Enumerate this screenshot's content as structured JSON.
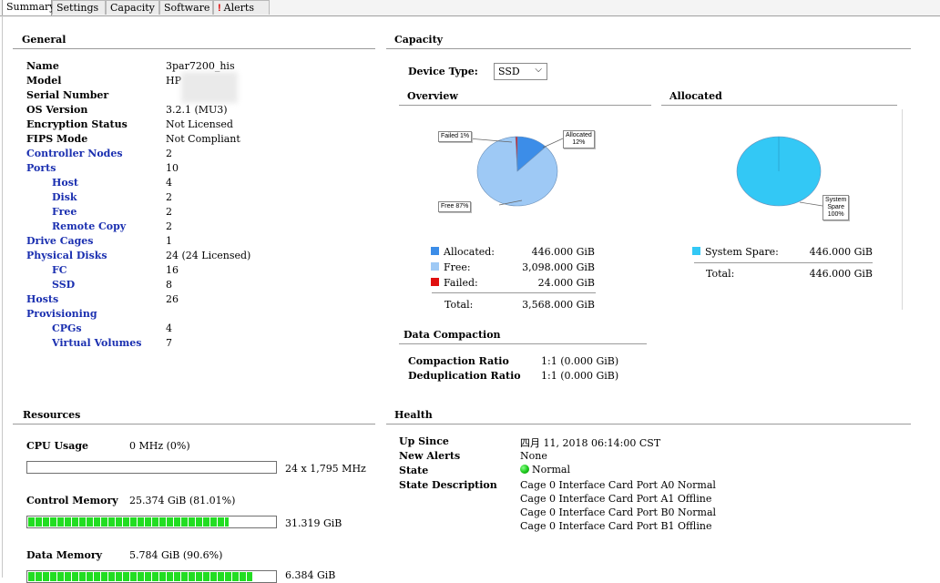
{
  "tabs": [
    {
      "label": "Summary",
      "active": true
    },
    {
      "label": "Settings"
    },
    {
      "label": "Capacity"
    },
    {
      "label": "Software"
    },
    {
      "label": "Alerts",
      "has_alert": true
    }
  ],
  "general": {
    "title": "General",
    "rows": [
      {
        "label": "Name",
        "value": "3par7200_his",
        "link": false,
        "indent": false
      },
      {
        "label": "Model",
        "value": "HP",
        "link": false,
        "indent": false
      },
      {
        "label": "Serial Number",
        "value": "",
        "link": false,
        "indent": false
      },
      {
        "label": "OS Version",
        "value": "3.2.1 (MU3)",
        "link": false,
        "indent": false
      },
      {
        "label": "Encryption Status",
        "value": "Not Licensed",
        "link": false,
        "indent": false
      },
      {
        "label": "FIPS Mode",
        "value": "Not Compliant",
        "link": false,
        "indent": false
      },
      {
        "label": "Controller Nodes",
        "value": "2",
        "link": true,
        "indent": false
      },
      {
        "label": "Ports",
        "value": "10",
        "link": true,
        "indent": false
      },
      {
        "label": "Host",
        "value": "4",
        "link": true,
        "indent": true
      },
      {
        "label": "Disk",
        "value": "2",
        "link": true,
        "indent": true
      },
      {
        "label": "Free",
        "value": "2",
        "link": true,
        "indent": true
      },
      {
        "label": "Remote Copy",
        "value": "2",
        "link": true,
        "indent": true
      },
      {
        "label": "Drive Cages",
        "value": "1",
        "link": true,
        "indent": false
      },
      {
        "label": "Physical Disks",
        "value": "24 (24 Licensed)",
        "link": true,
        "indent": false
      },
      {
        "label": "FC",
        "value": "16",
        "link": true,
        "indent": true
      },
      {
        "label": "SSD",
        "value": "8",
        "link": true,
        "indent": true
      },
      {
        "label": "Hosts",
        "value": "26",
        "link": true,
        "indent": false
      },
      {
        "label": "Provisioning",
        "value": "",
        "link": true,
        "indent": false
      },
      {
        "label": "CPGs",
        "value": "4",
        "link": true,
        "indent": true
      },
      {
        "label": "Virtual Volumes",
        "value": "7",
        "link": true,
        "indent": true
      }
    ]
  },
  "capacity": {
    "title": "Capacity",
    "device_type_label": "Device Type:",
    "device_type_value": "SSD",
    "overview": {
      "title": "Overview",
      "slices": [
        {
          "name": "Allocated",
          "percent": 12.5,
          "color": "#3c8de8",
          "callout": "Allocated\n12%"
        },
        {
          "name": "Free",
          "percent": 86.8,
          "color": "#9ec9f5",
          "callout": "Free 87%"
        },
        {
          "name": "Failed",
          "percent": 0.7,
          "color": "#e01010",
          "callout": "Failed 1%"
        }
      ],
      "legend": [
        {
          "label": "Allocated:",
          "value": "446.000 GiB",
          "color": "#3c8de8"
        },
        {
          "label": "Free:",
          "value": "3,098.000 GiB",
          "color": "#9ec9f5"
        },
        {
          "label": "Failed:",
          "value": "24.000 GiB",
          "color": "#e01010"
        }
      ],
      "total_label": "Total:",
      "total_value": "3,568.000 GiB"
    },
    "allocated": {
      "title": "Allocated",
      "slices": [
        {
          "name": "System Spare",
          "percent": 100,
          "color": "#33c8f5",
          "callout": "System\nSpare\n100%"
        }
      ],
      "legend": [
        {
          "label": "System Spare:",
          "value": "446.000 GiB",
          "color": "#33c8f5"
        }
      ],
      "total_label": "Total:",
      "total_value": "446.000 GiB"
    },
    "compaction": {
      "title": "Data Compaction",
      "rows": [
        {
          "label": "Compaction Ratio",
          "value": "1:1 (0.000 GiB)"
        },
        {
          "label": "Deduplication Ratio",
          "value": "1:1 (0.000 GiB)"
        }
      ]
    }
  },
  "resources": {
    "title": "Resources",
    "items": [
      {
        "label": "CPU Usage",
        "value": "0 MHz (0%)",
        "fraction": 0.0,
        "right": "24 x 1,795 MHz"
      },
      {
        "label": "Control Memory",
        "value": "25.374 GiB (81.01%)",
        "fraction": 0.8101,
        "right": "31.319 GiB"
      },
      {
        "label": "Data Memory",
        "value": "5.784 GiB (90.6%)",
        "fraction": 0.906,
        "right": "6.384 GiB"
      }
    ]
  },
  "health": {
    "title": "Health",
    "up_since_label": "Up Since",
    "up_since_value": "四月 11, 2018 06:14:00 CST",
    "new_alerts_label": "New Alerts",
    "new_alerts_value": "None",
    "state_label": "State",
    "state_value": "Normal",
    "state_desc_label": "State Description",
    "state_desc": [
      "Cage 0 Interface Card Port A0 Normal",
      "Cage 0 Interface Card Port A1 Offline",
      "Cage 0 Interface Card Port B0 Normal",
      "Cage 0 Interface Card Port B1 Offline"
    ]
  }
}
